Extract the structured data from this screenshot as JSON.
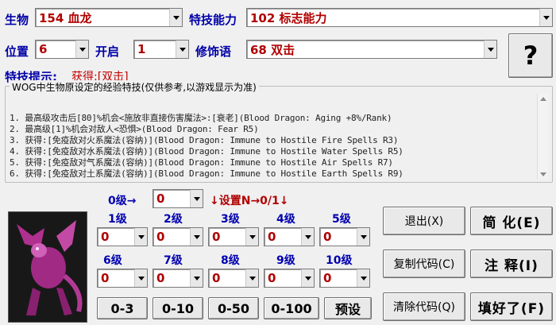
{
  "labels": {
    "creature": "生物",
    "ability": "特技能力",
    "position": "位置",
    "enable": "开启",
    "modifier": "修饰语",
    "hint": "特技提示:"
  },
  "combos": {
    "creature": "154 血龙",
    "ability": "102 标志能力",
    "position": "6",
    "enable": "1",
    "modifier": "68 双击",
    "level0": "0",
    "level1": "0",
    "level2": "0",
    "level3": "0",
    "level4": "0",
    "level5": "0",
    "level6": "0",
    "level7": "0",
    "level8": "0",
    "level9": "0",
    "level10": "0"
  },
  "help_button": "?",
  "hint_value": "获得:[双击]",
  "hint_box": {
    "title": "WOG中生物原设定的经验特技(仅供参考,以游戏显示为准)",
    "lines": [
      "1. 最高级攻击后[80]%机会<施放非直接伤害魔法>:[衰老](Blood Dragon: Aging +8%/Rank)",
      "2. 最高级[1]%机会对敌人<恐惧>(Blood Dragon: Fear R5)",
      "3. 获得:[免疫敌对火系魔法(容纳)](Blood Dragon: Immune to Hostile Fire Spells R3)",
      "4. 获得:[免疫敌对水系魔法(容纳)](Blood Dragon: Immune to Hostile Water Spells R5)",
      "5. 获得:[免疫敌对气系魔法(容纳)](Blood Dragon: Immune to Hostile Air Spells R7)",
      "6. 获得:[免疫敌对土系魔法(容纳)](Blood Dragon: Immune to Hostile Earth Spells R9)"
    ]
  },
  "levels": {
    "level0": "0级→",
    "set_hint": "↓设置N→0/1↓",
    "l1": "1级",
    "l2": "2级",
    "l3": "3级",
    "l4": "4级",
    "l5": "5级",
    "l6": "6级",
    "l7": "7级",
    "l8": "8级",
    "l9": "9级",
    "l10": "10级"
  },
  "range_buttons": [
    "0-3",
    "0-10",
    "0-50",
    "0-100",
    "预设"
  ],
  "action_buttons": {
    "exit": "退出(X)",
    "copy_code": "复制代码(C)",
    "clear_code": "清除代码(Q)",
    "simplify": "简 化(E)",
    "annotate": "注 释(I)",
    "done": "填好了(F)"
  },
  "colors": {
    "label_blue": "#0000a8",
    "value_red": "#b00000",
    "hint_red": "#c00000"
  }
}
